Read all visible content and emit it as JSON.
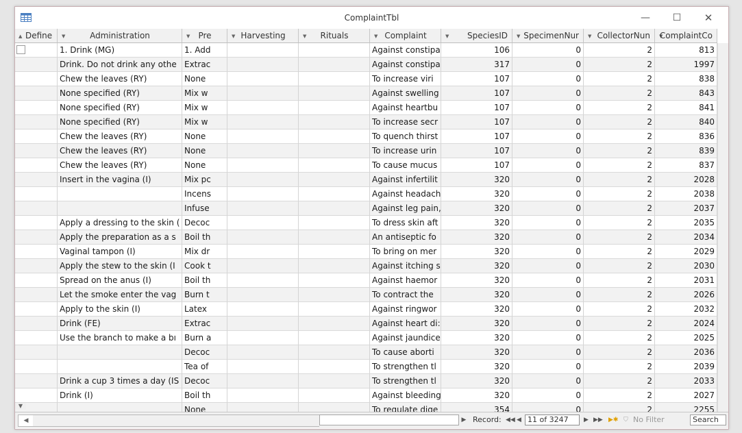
{
  "window": {
    "title": "ComplaintTbl",
    "minimize": "—",
    "maximize": "☐",
    "close": "✕"
  },
  "columns": [
    {
      "label": "Define",
      "key": "define"
    },
    {
      "label": "Administration",
      "key": "administration"
    },
    {
      "label": "Pre",
      "key": "pre"
    },
    {
      "label": "Harvesting",
      "key": "harvesting"
    },
    {
      "label": "Rituals",
      "key": "rituals"
    },
    {
      "label": "Complaint",
      "key": "complaint"
    },
    {
      "label": "SpeciesID",
      "key": "species"
    },
    {
      "label": "SpecimenNur",
      "key": "specimen"
    },
    {
      "label": "CollectorNun",
      "key": "collector"
    },
    {
      "label": "ComplaintCo",
      "key": "code"
    }
  ],
  "rows": [
    [
      "",
      "1. Drink (MG)",
      "1. Add",
      "",
      "",
      "Against constipa",
      "106",
      "0",
      "2",
      "813"
    ],
    [
      "",
      "Drink. Do not drink any othe",
      "Extrac",
      "",
      "",
      "Against constipa",
      "317",
      "0",
      "2",
      "1997"
    ],
    [
      "",
      "Chew the leaves (RY)",
      "None",
      "",
      "",
      "To increase  viri",
      "107",
      "0",
      "2",
      "838"
    ],
    [
      "",
      "None specified (RY)",
      "Mix w",
      "",
      "",
      "Against swelling",
      "107",
      "0",
      "2",
      "843"
    ],
    [
      "",
      "None specified (RY)",
      "Mix w",
      "",
      "",
      "Against heartbu",
      "107",
      "0",
      "2",
      "841"
    ],
    [
      "",
      "None specified (RY)",
      "Mix w",
      "",
      "",
      "To increase secr",
      "107",
      "0",
      "2",
      "840"
    ],
    [
      "",
      "Chew the leaves (RY)",
      "None",
      "",
      "",
      "To quench thirst",
      "107",
      "0",
      "2",
      "836"
    ],
    [
      "",
      "Chew the leaves (RY)",
      "None",
      "",
      "",
      "To increase urin",
      "107",
      "0",
      "2",
      "839"
    ],
    [
      "",
      "Chew the leaves (RY)",
      "None",
      "",
      "",
      "To cause mucus",
      "107",
      "0",
      "2",
      "837"
    ],
    [
      "",
      "Insert in the vagina (I)",
      "Mix pc",
      "",
      "",
      "Against infertilit",
      "320",
      "0",
      "2",
      "2028"
    ],
    [
      "",
      "",
      "Incens",
      "",
      "",
      "Against headach",
      "320",
      "0",
      "2",
      "2038"
    ],
    [
      "",
      "",
      "Infuse",
      "",
      "",
      "Against leg pain,",
      "320",
      "0",
      "2",
      "2037"
    ],
    [
      "",
      "Apply a dressing to the skin (",
      "Decoc",
      "",
      "",
      "To dress skin aft",
      "320",
      "0",
      "2",
      "2035"
    ],
    [
      "",
      "Apply the preparation as a s",
      "Boil th",
      "",
      "",
      "An antiseptic fo",
      "320",
      "0",
      "2",
      "2034"
    ],
    [
      "",
      "Vaginal tampon (I)",
      "Mix dr",
      "",
      "",
      "To bring on mer",
      "320",
      "0",
      "2",
      "2029"
    ],
    [
      "",
      "Apply the stew to the skin (I",
      "Cook t",
      "",
      "",
      "Against itching s",
      "320",
      "0",
      "2",
      "2030"
    ],
    [
      "",
      "Spread on the anus (I)",
      "Boil th",
      "",
      "",
      "Against haemor",
      "320",
      "0",
      "2",
      "2031"
    ],
    [
      "",
      "Let the smoke enter the vag",
      "Burn t",
      "",
      "",
      "To contract the",
      "320",
      "0",
      "2",
      "2026"
    ],
    [
      "",
      "Apply to the skin (I)",
      "Latex",
      "",
      "",
      "Against ringwor",
      "320",
      "0",
      "2",
      "2032"
    ],
    [
      "",
      "Drink (FE)",
      "Extrac",
      "",
      "",
      "Against heart di:",
      "320",
      "0",
      "2",
      "2024"
    ],
    [
      "",
      "Use the branch to make a bı",
      "Burn a",
      "",
      "",
      "Against jaundice",
      "320",
      "0",
      "2",
      "2025"
    ],
    [
      "",
      "",
      "Decoc",
      "",
      "",
      "To cause aborti",
      "320",
      "0",
      "2",
      "2036"
    ],
    [
      "",
      "",
      "Tea of",
      "",
      "",
      "To strengthen tl",
      "320",
      "0",
      "2",
      "2039"
    ],
    [
      "",
      "Drink a cup 3 times a day (IS",
      "Decoc",
      "",
      "",
      "To strengthen tl",
      "320",
      "0",
      "2",
      "2033"
    ],
    [
      "",
      "Drink (I)",
      "Boil th",
      "",
      "",
      "Against bleeding",
      "320",
      "0",
      "2",
      "2027"
    ],
    [
      "",
      "",
      "None",
      "",
      "",
      "To regulate dige",
      "354",
      "0",
      "2",
      "2255"
    ]
  ],
  "nav": {
    "record_label": "Record:",
    "first": "◀◀",
    "prev": "◀",
    "record_value": "11 of 3247",
    "next": "▶",
    "last": "▶▶",
    "filter": "No Filter",
    "search": "Search"
  },
  "colors": {
    "accent": "#fcdc8a",
    "border": "#c8aeb2"
  }
}
